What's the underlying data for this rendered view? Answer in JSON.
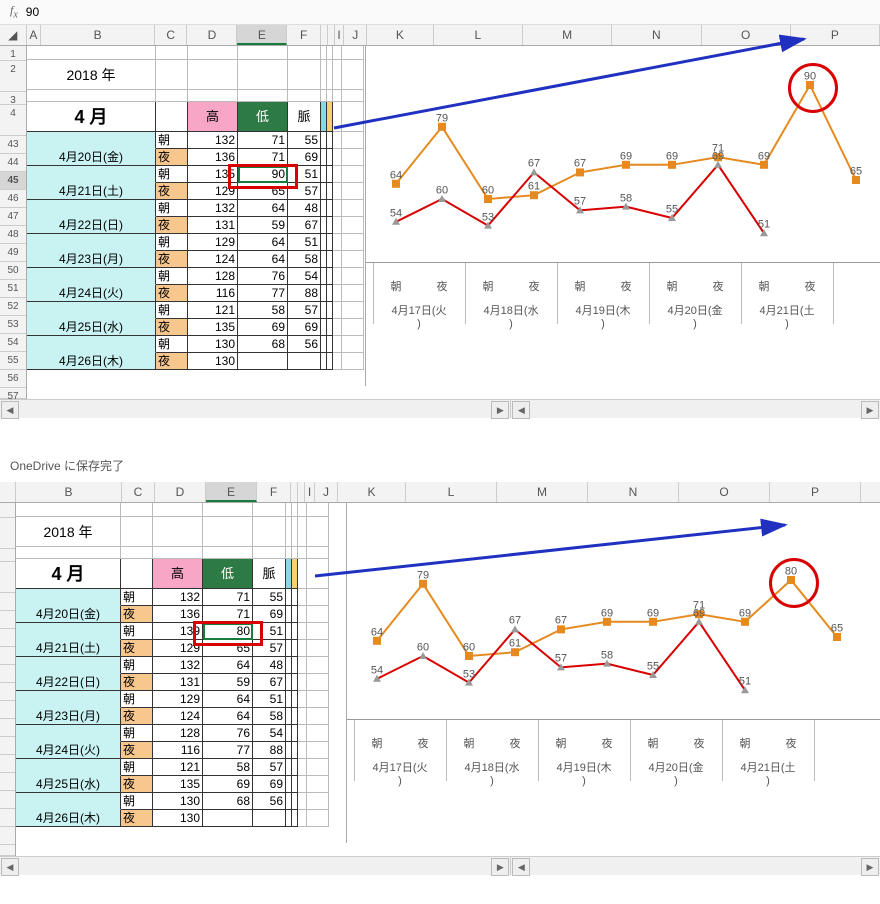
{
  "pane1": {
    "formula_value": "90",
    "columns_left": [
      "A",
      "B",
      "C",
      "D",
      "E",
      "F",
      "",
      "",
      "I",
      "J"
    ],
    "col_E_selected": true,
    "columns_right": [
      "K",
      "L",
      "M",
      "N",
      "O",
      "P"
    ],
    "year": "2018 年",
    "month": "4 月",
    "headers": {
      "high": "高",
      "low": "低",
      "pulse": "脈"
    },
    "row_nums_visible": [
      "1",
      "2",
      "3",
      "4",
      "43",
      "44",
      "45",
      "46",
      "47",
      "48",
      "49",
      "50",
      "51",
      "52",
      "53",
      "54",
      "55",
      "56",
      "57"
    ],
    "selected_row": "45",
    "selected_cell_value": "90",
    "redbox_range": "E45",
    "rows": [
      {
        "date": "",
        "ampm": "朝",
        "high": 132,
        "low": 71,
        "pulse": 55
      },
      {
        "date": "4月20日(金)",
        "ampm": "夜",
        "high": 136,
        "low": 71,
        "pulse": 69
      },
      {
        "date": "",
        "ampm": "朝",
        "high": 135,
        "low": 90,
        "pulse": 51
      },
      {
        "date": "4月21日(土)",
        "ampm": "夜",
        "high": 129,
        "low": 65,
        "pulse": 57
      },
      {
        "date": "",
        "ampm": "朝",
        "high": 132,
        "low": 64,
        "pulse": 48
      },
      {
        "date": "4月22日(日)",
        "ampm": "夜",
        "high": 131,
        "low": 59,
        "pulse": 67
      },
      {
        "date": "",
        "ampm": "朝",
        "high": 129,
        "low": 64,
        "pulse": 51
      },
      {
        "date": "4月23日(月)",
        "ampm": "夜",
        "high": 124,
        "low": 64,
        "pulse": 58
      },
      {
        "date": "",
        "ampm": "朝",
        "high": 128,
        "low": 76,
        "pulse": 54
      },
      {
        "date": "4月24日(火)",
        "ampm": "夜",
        "high": 116,
        "low": 77,
        "pulse": 88
      },
      {
        "date": "",
        "ampm": "朝",
        "high": 121,
        "low": 58,
        "pulse": 57
      },
      {
        "date": "4月25日(水)",
        "ampm": "夜",
        "high": 135,
        "low": 69,
        "pulse": 69
      },
      {
        "date": "",
        "ampm": "朝",
        "high": 130,
        "low": 68,
        "pulse": 56
      },
      {
        "date": "4月26日(木)",
        "ampm": "夜",
        "high": 130,
        "low": "",
        "pulse": ""
      }
    ],
    "chart_data": {
      "type": "line",
      "x_ticks": [
        "朝",
        "夜",
        "朝",
        "夜",
        "朝",
        "夜",
        "朝",
        "夜",
        "朝",
        "夜"
      ],
      "date_ticks": [
        "4月17日(火)",
        "4月18日(水)",
        "4月19日(木)",
        "4月20日(金)",
        "4月21日(土)"
      ],
      "series": [
        {
          "name": "low",
          "color": "#e68a1f",
          "values": [
            64,
            79,
            60,
            61,
            67,
            69,
            69,
            71,
            69,
            90,
            65
          ]
        },
        {
          "name": "pulse",
          "color": "#d80000",
          "values": [
            54,
            60,
            53,
            67,
            57,
            58,
            55,
            69,
            51,
            ""
          ]
        }
      ],
      "highlight": {
        "index": 9,
        "value": 90
      },
      "ylim": [
        45,
        95
      ]
    }
  },
  "pane2": {
    "saved_text": "OneDrive に保存完了",
    "columns_left": [
      "B",
      "C",
      "D",
      "E",
      "F",
      "",
      "",
      "I",
      "J"
    ],
    "columns_right": [
      "K",
      "L",
      "M",
      "N",
      "O",
      "P"
    ],
    "year": "2018 年",
    "month": "4 月",
    "headers": {
      "high": "高",
      "low": "低",
      "pulse": "脈"
    },
    "selected_cell_value": "80",
    "rows": [
      {
        "date": "",
        "ampm": "朝",
        "high": 132,
        "low": 71,
        "pulse": 55
      },
      {
        "date": "4月20日(金)",
        "ampm": "夜",
        "high": 136,
        "low": 71,
        "pulse": 69
      },
      {
        "date": "",
        "ampm": "朝",
        "high": 139,
        "low": 80,
        "pulse": 51
      },
      {
        "date": "4月21日(土)",
        "ampm": "夜",
        "high": 129,
        "low": 65,
        "pulse": 57
      },
      {
        "date": "",
        "ampm": "朝",
        "high": 132,
        "low": 64,
        "pulse": 48
      },
      {
        "date": "4月22日(日)",
        "ampm": "夜",
        "high": 131,
        "low": 59,
        "pulse": 67
      },
      {
        "date": "",
        "ampm": "朝",
        "high": 129,
        "low": 64,
        "pulse": 51
      },
      {
        "date": "4月23日(月)",
        "ampm": "夜",
        "high": 124,
        "low": 64,
        "pulse": 58
      },
      {
        "date": "",
        "ampm": "朝",
        "high": 128,
        "low": 76,
        "pulse": 54
      },
      {
        "date": "4月24日(火)",
        "ampm": "夜",
        "high": 116,
        "low": 77,
        "pulse": 88
      },
      {
        "date": "",
        "ampm": "朝",
        "high": 121,
        "low": 58,
        "pulse": 57
      },
      {
        "date": "4月25日(水)",
        "ampm": "夜",
        "high": 135,
        "low": 69,
        "pulse": 69
      },
      {
        "date": "",
        "ampm": "朝",
        "high": 130,
        "low": 68,
        "pulse": 56
      },
      {
        "date": "4月26日(木)",
        "ampm": "夜",
        "high": 130,
        "low": "",
        "pulse": ""
      }
    ],
    "chart_data": {
      "type": "line",
      "x_ticks": [
        "朝",
        "夜",
        "朝",
        "夜",
        "朝",
        "夜",
        "朝",
        "夜",
        "朝",
        "夜"
      ],
      "date_ticks": [
        "4月17日(火)",
        "4月18日(水)",
        "4月19日(木)",
        "4月20日(金)",
        "4月21日(土)"
      ],
      "series": [
        {
          "name": "low",
          "color": "#e68a1f",
          "values": [
            64,
            79,
            60,
            61,
            67,
            69,
            69,
            71,
            69,
            80,
            65
          ]
        },
        {
          "name": "pulse",
          "color": "#d80000",
          "values": [
            54,
            60,
            53,
            67,
            57,
            58,
            55,
            69,
            51,
            ""
          ]
        }
      ],
      "highlight": {
        "index": 9,
        "value": 80
      },
      "ylim": [
        45,
        95
      ]
    }
  }
}
